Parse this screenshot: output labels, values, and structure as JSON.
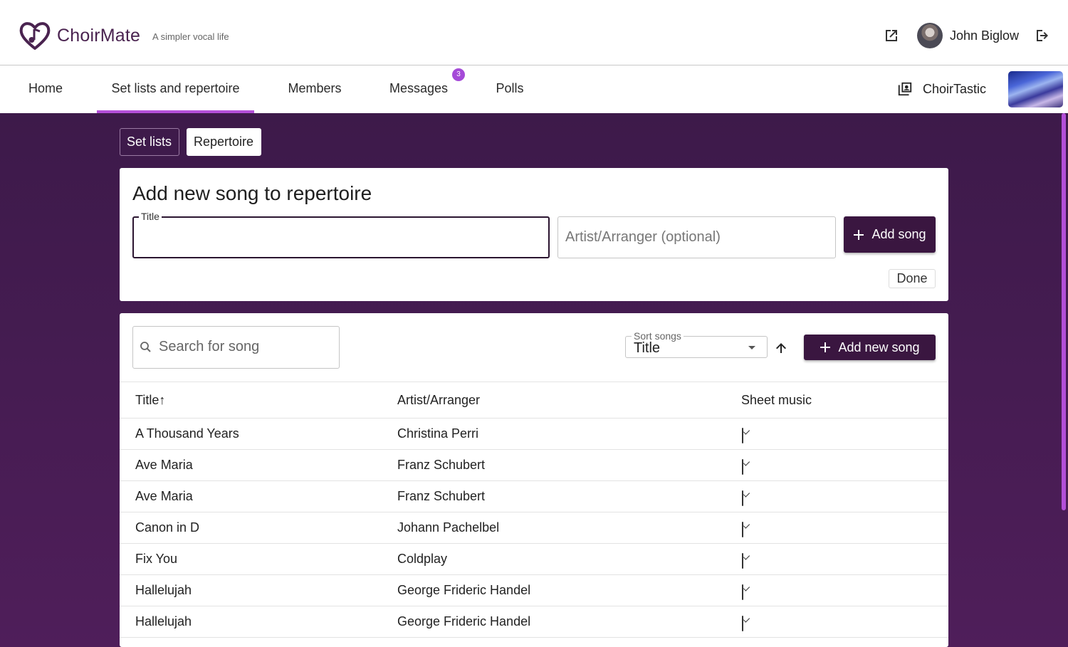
{
  "app": {
    "brand": "ChoirMate",
    "tagline": "A simpler vocal life",
    "user_name": "John Biglow",
    "choir_name": "ChoirTastic",
    "accent_color": "#b34fd8",
    "primary_color": "#3a1640"
  },
  "icons": {
    "logo": "heart-music-logo",
    "external": "open-external-icon",
    "logout": "logout-icon",
    "choir": "library-music-icon",
    "search": "search-icon",
    "sort_direction": "arrow-up-icon",
    "add": "plus-icon",
    "checkbox": "checked-box-icon"
  },
  "nav": {
    "items": [
      {
        "label": "Home",
        "active": false
      },
      {
        "label": "Set lists and repertoire",
        "active": true
      },
      {
        "label": "Members",
        "active": false
      },
      {
        "label": "Messages",
        "active": false,
        "badge": "3"
      },
      {
        "label": "Polls",
        "active": false
      }
    ]
  },
  "tabs": {
    "set_lists": "Set lists",
    "repertoire": "Repertoire",
    "selected": "Repertoire"
  },
  "add_form": {
    "title": "Add new song to repertoire",
    "title_label": "Title",
    "title_value": "",
    "artist_placeholder": "Artist/Arranger (optional)",
    "add_button": "Add song",
    "done_button": "Done"
  },
  "list": {
    "search_placeholder": "Search for song",
    "sort_label": "Sort songs",
    "sort_value": "Title",
    "add_new_button": "Add new song",
    "columns": [
      "Title↑",
      "Artist/Arranger",
      "Sheet music"
    ],
    "rows": [
      {
        "title": "A Thousand Years",
        "artist": "Christina Perri",
        "sheet_music": true
      },
      {
        "title": "Ave Maria",
        "artist": "Franz Schubert",
        "sheet_music": true
      },
      {
        "title": "Ave Maria",
        "artist": "Franz Schubert",
        "sheet_music": true
      },
      {
        "title": "Canon in D",
        "artist": "Johann Pachelbel",
        "sheet_music": true
      },
      {
        "title": "Fix You",
        "artist": "Coldplay",
        "sheet_music": true
      },
      {
        "title": "Hallelujah",
        "artist": "George Frideric Handel",
        "sheet_music": true
      },
      {
        "title": "Hallelujah",
        "artist": "George Frideric Handel",
        "sheet_music": true
      }
    ]
  }
}
